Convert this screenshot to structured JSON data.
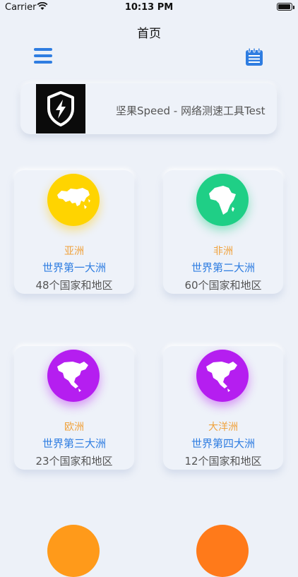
{
  "status_bar": {
    "carrier": "Carrier",
    "time": "10:13 PM"
  },
  "nav": {
    "title": "首页"
  },
  "banner": {
    "text": "坚果Speed - 网络测速工具Test"
  },
  "continents": [
    {
      "name": "亚洲",
      "rank": "世界第一大洲",
      "count": "48个国家和地区",
      "color": "#ffd400",
      "icon": "asia-map-icon"
    },
    {
      "name": "非洲",
      "rank": "世界第二大洲",
      "count": "60个国家和地区",
      "color": "#1fcf86",
      "icon": "africa-map-icon"
    },
    {
      "name": "欧洲",
      "rank": "世界第三大洲",
      "count": "23个国家和地区",
      "color": "#b51ef0",
      "icon": "north-america-map-icon"
    },
    {
      "name": "大洋洲",
      "rank": "世界第四大洲",
      "count": "12个国家和地区",
      "color": "#b51ef0",
      "icon": "north-america-map-icon"
    }
  ],
  "colors": {
    "accent": "#2f7de1",
    "name_color": "#f0a23c",
    "peek_left": "#ff9a1a",
    "peek_right": "#ff7a1a"
  }
}
